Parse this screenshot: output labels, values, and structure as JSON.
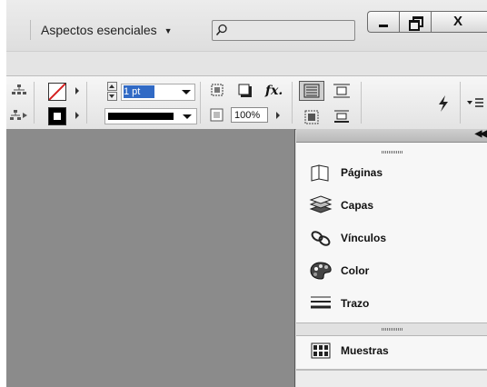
{
  "titlebar": {
    "workspace_label": "Aspectos esenciales",
    "search_placeholder": "",
    "close_glyph": "X"
  },
  "control": {
    "stroke_weight": "1 pt",
    "opacity": "100%",
    "effects_label": "fx."
  },
  "panels": [
    {
      "label": "Páginas",
      "icon": "pages-icon"
    },
    {
      "label": "Capas",
      "icon": "layers-icon"
    },
    {
      "label": "Vínculos",
      "icon": "links-icon"
    },
    {
      "label": "Color",
      "icon": "palette-icon"
    },
    {
      "label": "Trazo",
      "icon": "stroke-icon"
    },
    {
      "label": "Muestras",
      "icon": "swatches-icon"
    }
  ],
  "colors": {
    "canvas": "#8b8b8b",
    "panel_bg": "#f7f7f7",
    "selection": "#316ac5",
    "no_fill_slash": "#d42020"
  }
}
